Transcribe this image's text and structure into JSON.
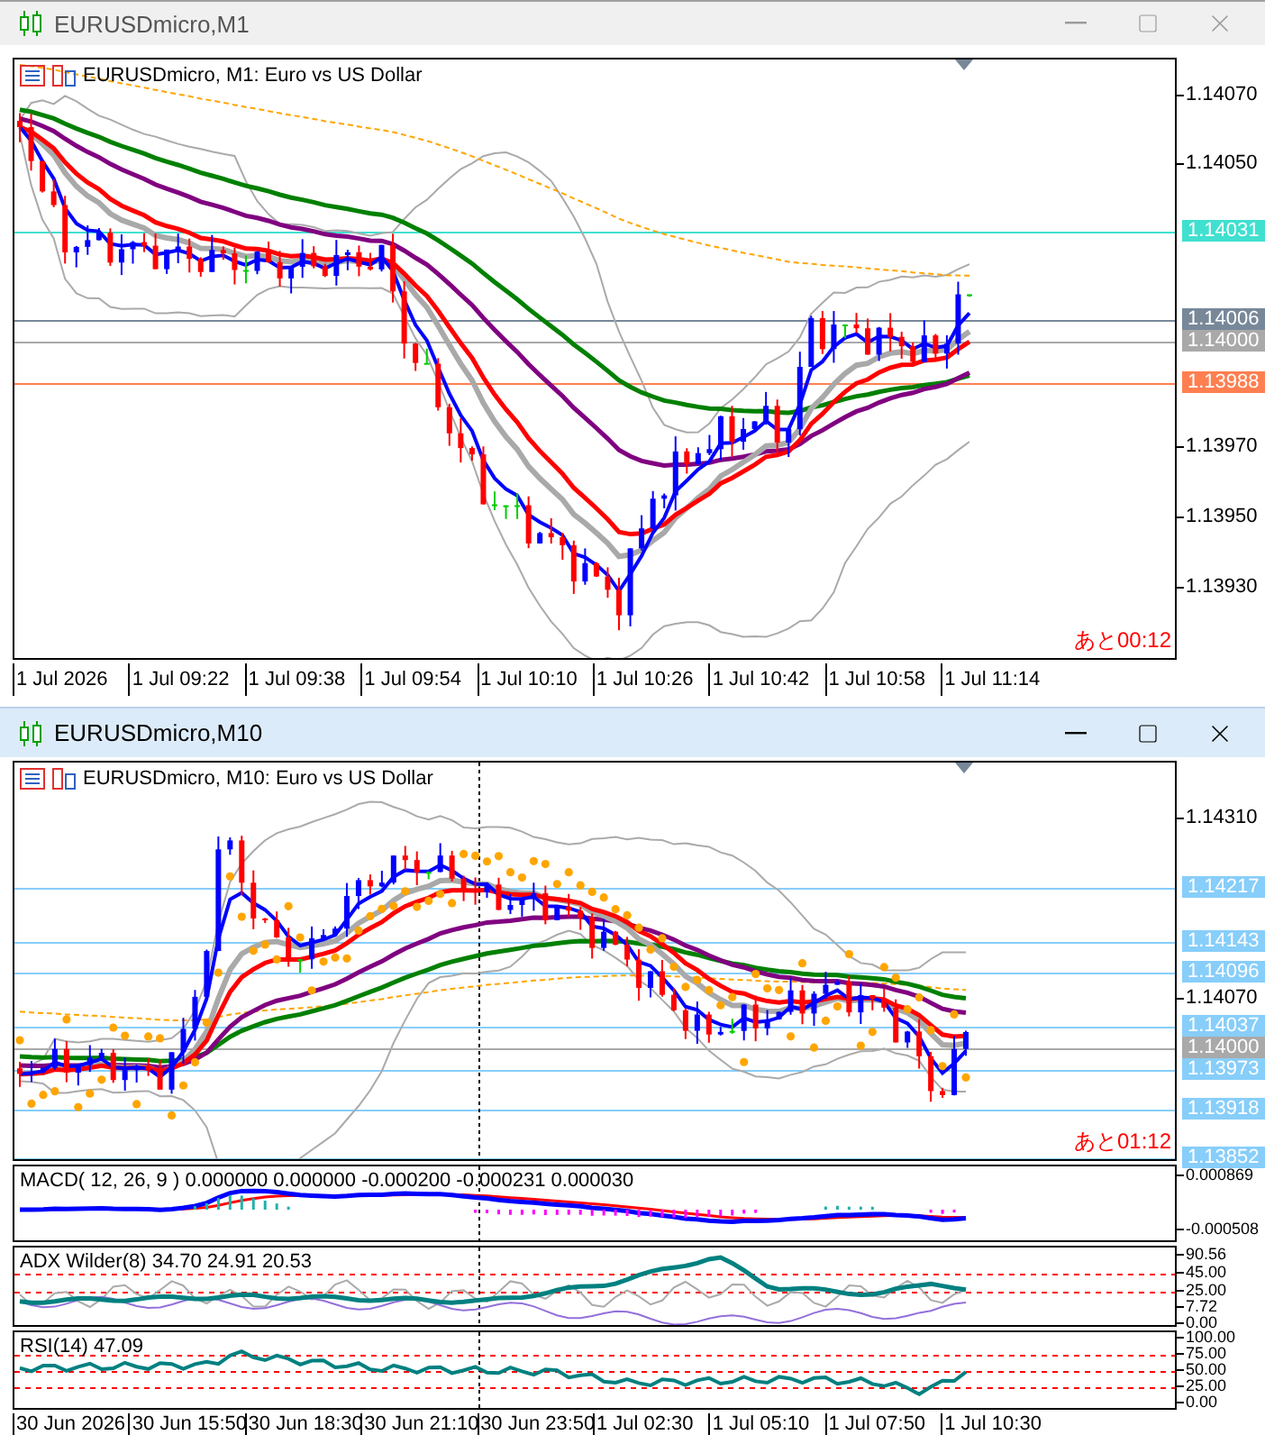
{
  "windows": [
    {
      "title": "EURUSDmicro,M1",
      "active": false,
      "chart": {
        "symbol_label": "EURUSDmicro, M1:  Euro vs US Dollar",
        "countdown": "あと00:12",
        "price_ticks": [
          "1.14070",
          "1.14050",
          "1.13970",
          "1.13950",
          "1.13930"
        ],
        "price_tags": [
          {
            "label": "1.14031",
            "color": "#40e0d0"
          },
          {
            "label": "1.14006",
            "color": "#778899"
          },
          {
            "label": "1.14000",
            "color": "#a9a9a9"
          },
          {
            "label": "1.13988",
            "color": "#ff7f50"
          }
        ],
        "time_labels": [
          "1 Jul 2026",
          "1 Jul 09:22",
          "1 Jul 09:38",
          "1 Jul 09:54",
          "1 Jul 10:10",
          "1 Jul 10:26",
          "1 Jul 10:42",
          "1 Jul 10:58",
          "1 Jul 11:14"
        ]
      }
    },
    {
      "title": "EURUSDmicro,M10",
      "active": true,
      "chart": {
        "symbol_label": "EURUSDmicro, M10:  Euro vs US Dollar",
        "countdown": "あと01:12",
        "price_ticks": [
          "1.14310",
          "1.14070"
        ],
        "price_tags": [
          {
            "label": "1.14217",
            "color": "#87cefa"
          },
          {
            "label": "1.14143",
            "color": "#87cefa"
          },
          {
            "label": "1.14096",
            "color": "#87cefa"
          },
          {
            "label": "1.14037",
            "color": "#87cefa"
          },
          {
            "label": "1.14000",
            "color": "#a9a9a9"
          },
          {
            "label": "1.13973",
            "color": "#87cefa"
          },
          {
            "label": "1.13918",
            "color": "#87cefa"
          },
          {
            "label": "1.13852",
            "color": "#87cefa"
          }
        ],
        "time_labels": [
          "30 Jun 2026",
          "30 Jun 15:50",
          "30 Jun 18:30",
          "30 Jun 21:10",
          "30 Jun 23:50",
          "1 Jul 02:30",
          "1 Jul 05:10",
          "1 Jul 07:50",
          "1 Jul 10:30"
        ]
      },
      "indicators": [
        {
          "kind": "macd",
          "label": "MACD( 12, 26, 9 ) 0.000000 0.000000 -0.000200 -0.000231 0.000030",
          "ticks": [
            "0.000869",
            "-0.000508"
          ]
        },
        {
          "kind": "adx",
          "label": "ADX Wilder(8) 34.70 24.91 20.53",
          "ticks": [
            "90.56",
            "45.00",
            "25.00",
            "7.72",
            "0.00"
          ]
        },
        {
          "kind": "rsi",
          "label": "RSI(14) 47.09",
          "ticks": [
            "100.00",
            "75.00",
            "50.00",
            "25.00",
            "0.00"
          ]
        }
      ]
    }
  ]
}
